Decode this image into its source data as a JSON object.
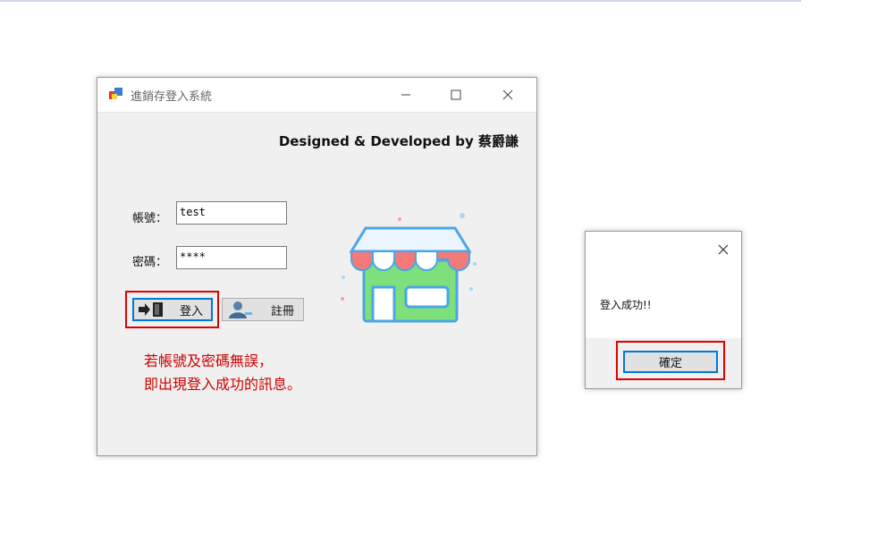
{
  "login_window": {
    "title": "進銷存登入系統",
    "designer_credit": "Designed & Developed by 蔡爵謙",
    "account_label": "帳號：",
    "account_value": "test",
    "password_label": "密碼：",
    "password_value": "****",
    "login_button": "登入",
    "register_button": "註冊"
  },
  "annotation": {
    "line1": "若帳號及密碼無誤，",
    "line2": "即出現登入成功的訊息。"
  },
  "message_box": {
    "text": "登入成功!!",
    "ok_button": "確定"
  },
  "colors": {
    "highlight": "#e00000",
    "accent": "#0078d7"
  }
}
